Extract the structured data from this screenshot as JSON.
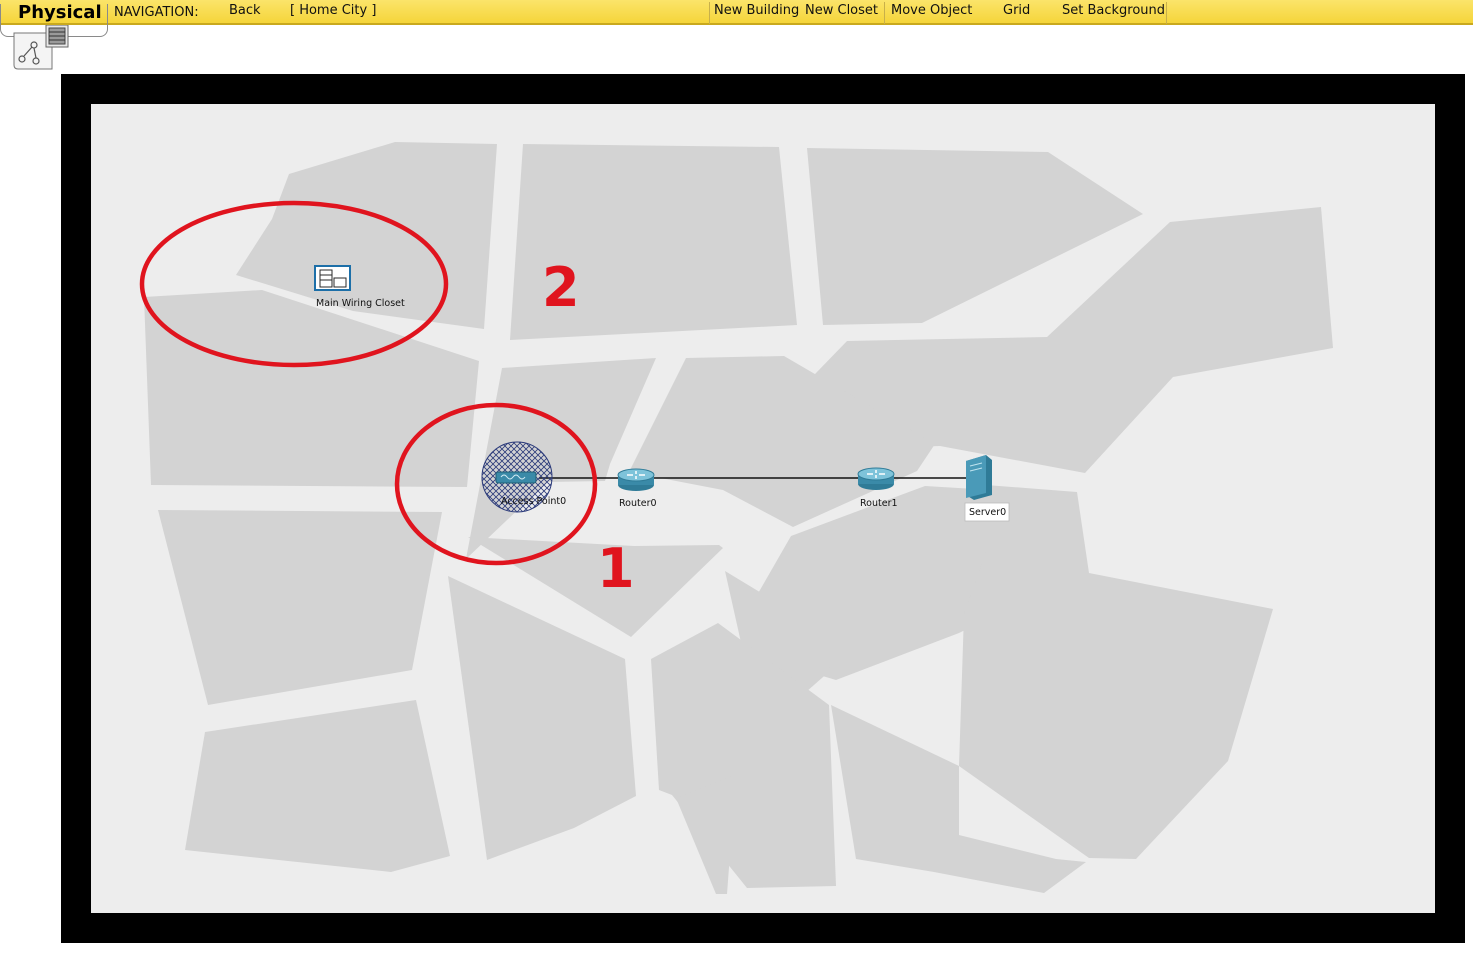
{
  "toolbar": {
    "mode": "Physical",
    "navigation_label": "NAVIGATION:",
    "back": "Back",
    "location": "[ Home City ]",
    "new_building": "New Building",
    "new_closet": "New Closet",
    "move_object": "Move Object",
    "grid": "Grid",
    "set_background": "Set Background"
  },
  "map": {
    "wiring_closet": {
      "label": "Main Wiring Closet"
    },
    "devices": {
      "access_point": "Access Point0",
      "router0": "Router0",
      "router1": "Router1",
      "server0": "Server0"
    },
    "annotations": {
      "one": "1",
      "two": "2"
    }
  },
  "colors": {
    "toolbar": "#f5d53a",
    "map_background": "#ededed",
    "block": "#d3d3d3",
    "frame": "#000000",
    "annotation": "#e0141e",
    "device": "#3a8aa8"
  }
}
